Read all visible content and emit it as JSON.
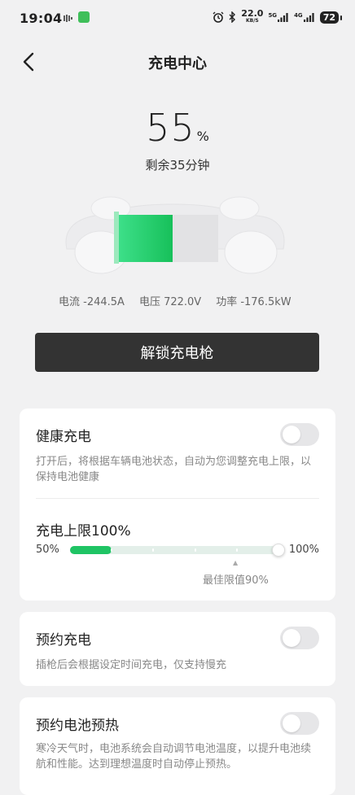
{
  "status_bar": {
    "time": "19:04",
    "net_speed": "22.0",
    "net_unit": "KB/S",
    "signal1": "5G",
    "signal2": "4G",
    "battery": "72"
  },
  "header": {
    "title": "充电中心"
  },
  "charge": {
    "percent": "55",
    "percent_unit": "%",
    "remaining": "剩余35分钟",
    "level": 0.55
  },
  "stats": {
    "current": "电流 -244.5A",
    "voltage": "电压 722.0V",
    "power": "功率 -176.5kW"
  },
  "unlock_button": "解锁充电枪",
  "healthy_charge": {
    "title": "健康充电",
    "desc": "打开后，将根据车辆电池状态，自动为您调整充电上限，以保持电池健康",
    "enabled": false
  },
  "charge_limit": {
    "title": "充电上限100%",
    "min_label": "50%",
    "max_label": "100%",
    "value": 100,
    "current_fill": 60,
    "best_label": "最佳限值90%",
    "best_mark": "▲"
  },
  "scheduled_charge": {
    "title": "预约充电",
    "desc": "插枪后会根据设定时间充电，仅支持慢充",
    "enabled": false
  },
  "battery_preheat": {
    "title": "预约电池预热",
    "desc": "寒冷天气时，电池系统会自动调节电池温度，以提升电池续航和性能。达到理想温度时自动停止预热。",
    "enabled": false
  },
  "colors": {
    "accent": "#1fc464",
    "button": "#333333"
  }
}
